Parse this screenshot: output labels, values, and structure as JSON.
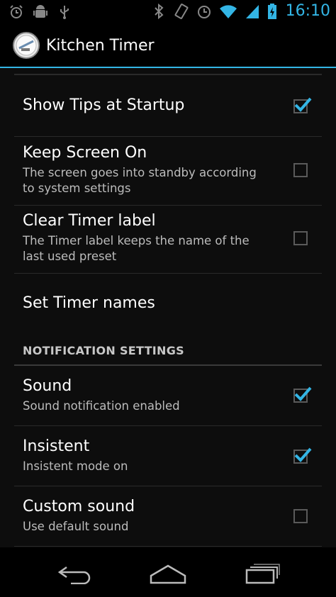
{
  "status_bar": {
    "time": "16:10",
    "icons": [
      "alarm-icon",
      "android-debug-icon",
      "usb-icon",
      "bluetooth-icon",
      "vibrate-icon",
      "alarm-clock-icon",
      "wifi-icon",
      "signal-icon",
      "battery-charging-icon"
    ],
    "accent": "#33b5e5"
  },
  "action_bar": {
    "title": "Kitchen Timer",
    "icon": "kitchen-timer-app-icon"
  },
  "settings": {
    "show_tips": {
      "title": "Show Tips at Startup",
      "checked": true
    },
    "keep_screen_on": {
      "title": "Keep Screen On",
      "summary": "The screen goes into standby according to system settings",
      "checked": false
    },
    "clear_timer_label": {
      "title": "Clear Timer label",
      "summary": "The Timer label keeps the name of the last used preset",
      "checked": false
    },
    "set_timer_names": {
      "title": "Set Timer names"
    },
    "notification_header": "NOTIFICATION SETTINGS",
    "sound": {
      "title": "Sound",
      "summary": "Sound notification enabled",
      "checked": true
    },
    "insistent": {
      "title": "Insistent",
      "summary": "Insistent mode on",
      "checked": true
    },
    "custom_sound": {
      "title": "Custom sound",
      "summary": "Use default sound",
      "checked": false
    }
  },
  "nav_bar": {
    "buttons": [
      "back-icon",
      "home-icon",
      "recents-icon"
    ]
  }
}
